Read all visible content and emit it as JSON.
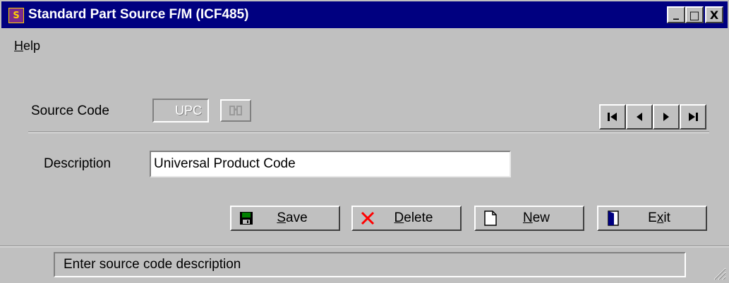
{
  "window": {
    "title": "Standard Part Source F/M (ICF485)",
    "icon": "app-icon",
    "controls": {
      "minimize": "_",
      "maximize": "□",
      "close": "X"
    }
  },
  "menu": {
    "help_prefix": "H",
    "help_rest": "elp"
  },
  "source_code": {
    "label": "Source Code",
    "value": "UPC",
    "lookup_icon": "binoculars-icon"
  },
  "navigation": {
    "first": "first-record-icon",
    "prev": "prev-record-icon",
    "next": "next-record-icon",
    "last": "last-record-icon"
  },
  "description": {
    "label": "Description",
    "value": "Universal Product Code"
  },
  "buttons": {
    "save": {
      "mn": "S",
      "rest": "ave",
      "icon": "floppy-disk-icon"
    },
    "delete": {
      "mn": "D",
      "rest": "elete",
      "icon": "delete-x-icon"
    },
    "new": {
      "mn": "N",
      "rest": "ew",
      "icon": "new-document-icon"
    },
    "exit": {
      "pre": "E",
      "mn": "x",
      "rest": "it",
      "icon": "exit-door-icon"
    }
  },
  "status": {
    "text": "Enter source code description"
  },
  "colors": {
    "titlebar": "#000080",
    "face": "#c0c0c0",
    "delete_red": "#ff0000",
    "save_green": "#008000"
  }
}
